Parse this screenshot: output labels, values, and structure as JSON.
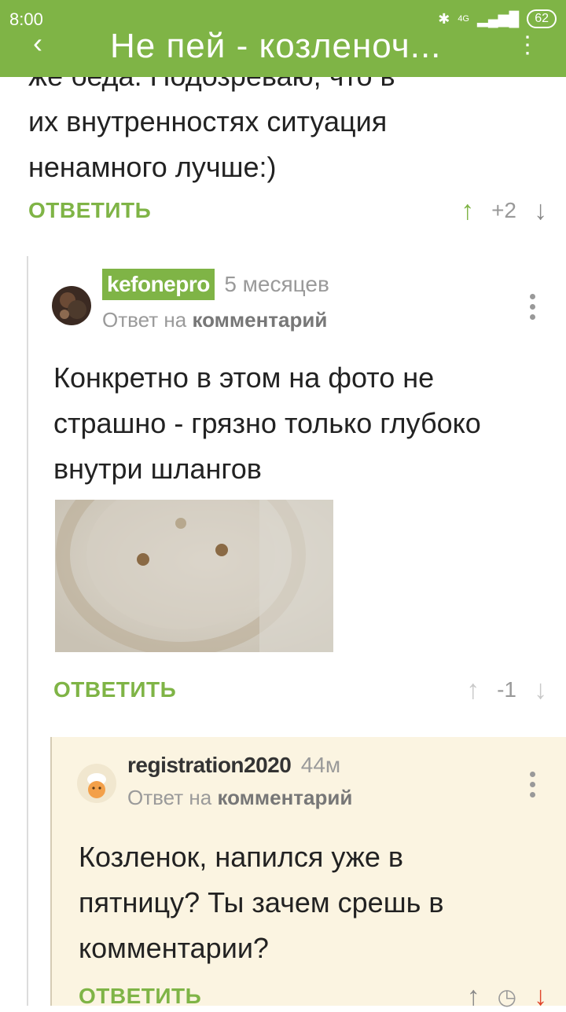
{
  "status": {
    "time": "8:00",
    "network": "4G",
    "battery": "62"
  },
  "appbar": {
    "title": "Не пей - козленоч...",
    "back": "‹",
    "menu": "⋮"
  },
  "prev": {
    "text_top": "же беда. Подозреваю, что в",
    "text": "их внутренностях ситуация ненамного лучше:)",
    "reply": "ОТВЕТИТЬ",
    "votes": "+2"
  },
  "comment1": {
    "author": "kefonepro",
    "time": "5 месяцев",
    "reply_prefix": "Ответ на",
    "reply_target": "комментарий",
    "body": "Конкретно в этом на фото не страшно - грязно только глубоко внутри шлангов",
    "reply": "ОТВЕТИТЬ",
    "votes": "-1"
  },
  "comment2": {
    "author": "registration2020",
    "time": "44м",
    "reply_prefix": "Ответ на",
    "reply_target": "комментарий",
    "body": "Козленок, напился уже в пятницу? Ты зачем срешь в комментарии?",
    "reply": "ОТВЕТИТЬ"
  },
  "colors": {
    "accent": "#7fb446",
    "highlight_bg": "#fbf4e1",
    "down_active": "#e0462c"
  }
}
